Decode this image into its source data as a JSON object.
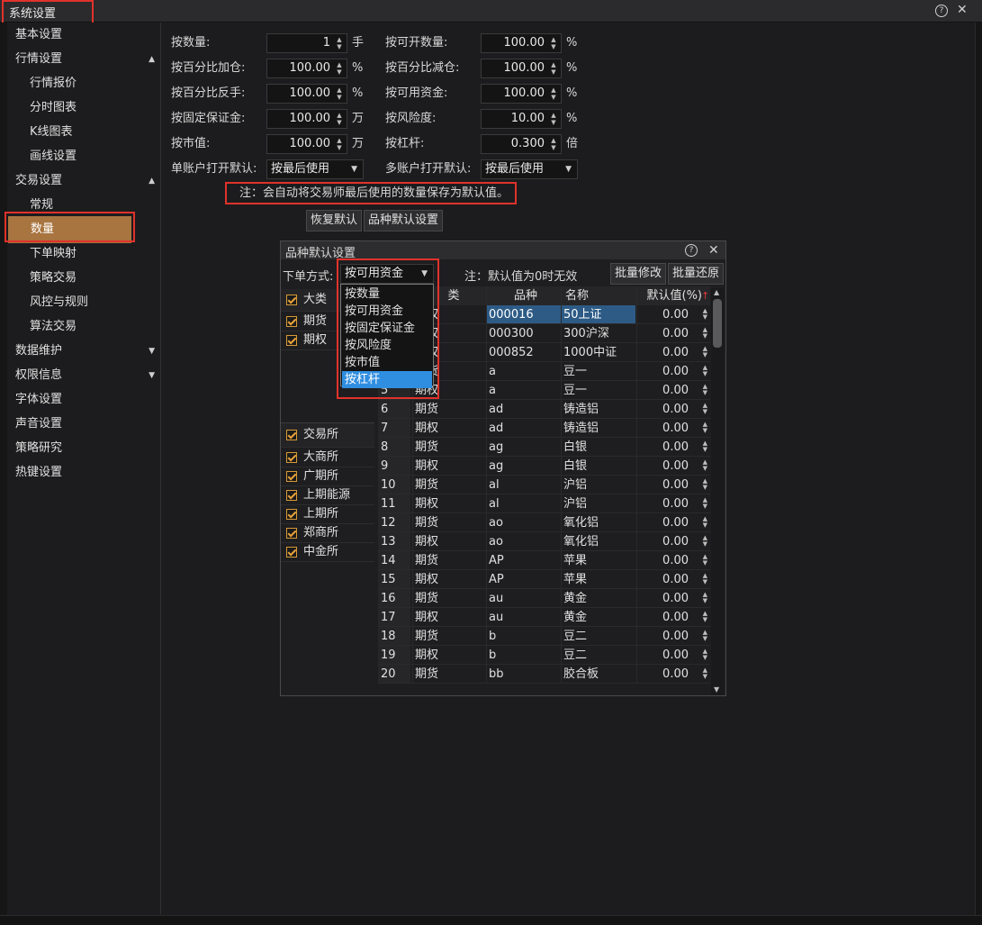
{
  "window": {
    "title": "系统设置",
    "help_icon": "help-circle-icon"
  },
  "sidebar": {
    "items": [
      {
        "label": "基本设置",
        "level": 1
      },
      {
        "label": "行情设置",
        "level": 1,
        "arrow": "▲"
      },
      {
        "label": "行情报价",
        "level": 2
      },
      {
        "label": "分时图表",
        "level": 2
      },
      {
        "label": "K线图表",
        "level": 2
      },
      {
        "label": "画线设置",
        "level": 2
      },
      {
        "label": "交易设置",
        "level": 1,
        "arrow": "▲"
      },
      {
        "label": "常规",
        "level": 2
      },
      {
        "label": "数量",
        "level": 2,
        "active": true
      },
      {
        "label": "下单映射",
        "level": 2
      },
      {
        "label": "策略交易",
        "level": 2
      },
      {
        "label": "风控与规则",
        "level": 2
      },
      {
        "label": "算法交易",
        "level": 2
      },
      {
        "label": "数据维护",
        "level": 1,
        "arrow": "▼"
      },
      {
        "label": "权限信息",
        "level": 1,
        "arrow": "▼"
      },
      {
        "label": "字体设置",
        "level": 1
      },
      {
        "label": "声音设置",
        "level": 1
      },
      {
        "label": "策略研究",
        "level": 1
      },
      {
        "label": "热键设置",
        "level": 1
      }
    ],
    "active_color": "#a8743f"
  },
  "form": {
    "left": [
      {
        "label": "按数量:",
        "value": "1",
        "unit": "手"
      },
      {
        "label": "按百分比加仓:",
        "value": "100.00",
        "unit": "%"
      },
      {
        "label": "按百分比反手:",
        "value": "100.00",
        "unit": "%"
      },
      {
        "label": "按固定保证金:",
        "value": "100.00",
        "unit": "万"
      },
      {
        "label": "按市值:",
        "value": "100.00",
        "unit": "万"
      }
    ],
    "right": [
      {
        "label": "按可开数量:",
        "value": "100.00",
        "unit": "%"
      },
      {
        "label": "按百分比减仓:",
        "value": "100.00",
        "unit": "%"
      },
      {
        "label": "按可用资金:",
        "value": "100.00",
        "unit": "%"
      },
      {
        "label": "按风险度:",
        "value": "10.00",
        "unit": "%"
      },
      {
        "label": "按杠杆:",
        "value": "0.300",
        "unit": "倍"
      }
    ],
    "single_label": "单账户打开默认:",
    "single_value": "按最后使用",
    "multi_label": "多账户打开默认:",
    "multi_value": "按最后使用",
    "note": "注：会自动将交易师最后使用的数量保存为默认值。",
    "restore_button": "恢复默认",
    "variety_button": "品种默认设置"
  },
  "dialog": {
    "title": "品种默认设置",
    "order_mode_label": "下单方式:",
    "order_mode_value": "按可用资金",
    "note": "注：默认值为0时无效",
    "batch_edit_button": "批量修改",
    "batch_restore_button": "批量还原",
    "category_header": "大类",
    "categories": [
      "期货",
      "期权"
    ],
    "exchange_header": "交易所",
    "exchanges": [
      "大商所",
      "广期所",
      "上期能源",
      "上期所",
      "郑商所",
      "中金所"
    ],
    "columns": {
      "type": "类",
      "symbol": "品种",
      "name": "名称",
      "default": "默认值(%)"
    },
    "rows": [
      {
        "no": "",
        "type": "期权",
        "symbol": "000016",
        "name": "50上证",
        "value": "0.00",
        "selected": true
      },
      {
        "no": "",
        "type": "期权",
        "symbol": "000300",
        "name": "300沪深",
        "value": "0.00"
      },
      {
        "no": "",
        "type": "期权",
        "symbol": "000852",
        "name": "1000中证",
        "value": "0.00"
      },
      {
        "no": "",
        "type": "期货",
        "symbol": "a",
        "name": "豆一",
        "value": "0.00"
      },
      {
        "no": "5",
        "type": "期权",
        "symbol": "a",
        "name": "豆一",
        "value": "0.00"
      },
      {
        "no": "6",
        "type": "期货",
        "symbol": "ad",
        "name": "铸造铝",
        "value": "0.00"
      },
      {
        "no": "7",
        "type": "期权",
        "symbol": "ad",
        "name": "铸造铝",
        "value": "0.00"
      },
      {
        "no": "8",
        "type": "期货",
        "symbol": "ag",
        "name": "白银",
        "value": "0.00"
      },
      {
        "no": "9",
        "type": "期权",
        "symbol": "ag",
        "name": "白银",
        "value": "0.00"
      },
      {
        "no": "10",
        "type": "期货",
        "symbol": "al",
        "name": "沪铝",
        "value": "0.00"
      },
      {
        "no": "11",
        "type": "期权",
        "symbol": "al",
        "name": "沪铝",
        "value": "0.00"
      },
      {
        "no": "12",
        "type": "期货",
        "symbol": "ao",
        "name": "氧化铝",
        "value": "0.00"
      },
      {
        "no": "13",
        "type": "期权",
        "symbol": "ao",
        "name": "氧化铝",
        "value": "0.00"
      },
      {
        "no": "14",
        "type": "期货",
        "symbol": "AP",
        "name": "苹果",
        "value": "0.00"
      },
      {
        "no": "15",
        "type": "期权",
        "symbol": "AP",
        "name": "苹果",
        "value": "0.00"
      },
      {
        "no": "16",
        "type": "期货",
        "symbol": "au",
        "name": "黄金",
        "value": "0.00"
      },
      {
        "no": "17",
        "type": "期权",
        "symbol": "au",
        "name": "黄金",
        "value": "0.00"
      },
      {
        "no": "18",
        "type": "期货",
        "symbol": "b",
        "name": "豆二",
        "value": "0.00"
      },
      {
        "no": "19",
        "type": "期权",
        "symbol": "b",
        "name": "豆二",
        "value": "0.00"
      },
      {
        "no": "20",
        "type": "期货",
        "symbol": "bb",
        "name": "胶合板",
        "value": "0.00"
      }
    ],
    "dropdown_options": [
      "按数量",
      "按可用资金",
      "按固定保证金",
      "按风险度",
      "按市值",
      "按杠杆"
    ],
    "dropdown_highlight": "按杠杆"
  }
}
